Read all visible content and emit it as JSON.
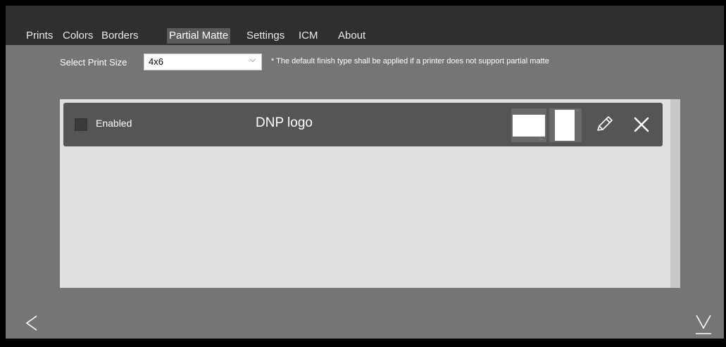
{
  "tabs": [
    {
      "label": "Prints",
      "active": false
    },
    {
      "label": "Colors",
      "active": false
    },
    {
      "label": "Borders",
      "active": false
    },
    {
      "label": "Partial Matte",
      "active": true
    },
    {
      "label": "Settings",
      "active": false
    },
    {
      "label": "ICM",
      "active": false
    },
    {
      "label": "About",
      "active": false
    }
  ],
  "print_size": {
    "label": "Select Print Size",
    "selected": "4x6",
    "note": "* The default finish type shall be applied if a printer does not support partial matte"
  },
  "items": [
    {
      "enabled_label": "Enabled",
      "enabled": false,
      "name": "DNP logo"
    }
  ],
  "icons": {
    "select_arrow": "chevron-down-icon",
    "edit": "pencil-icon",
    "delete": "close-icon",
    "back": "chevron-left-icon",
    "download": "download-icon",
    "thumbnails": [
      "landscape-thumbnail",
      "portrait-thumbnail"
    ]
  },
  "colors": {
    "background": "#757575",
    "tab_bar": "#2f2f2f",
    "active_tab": "#5a5a5a",
    "list_panel": "#e0e0e0",
    "row": "#555555"
  }
}
